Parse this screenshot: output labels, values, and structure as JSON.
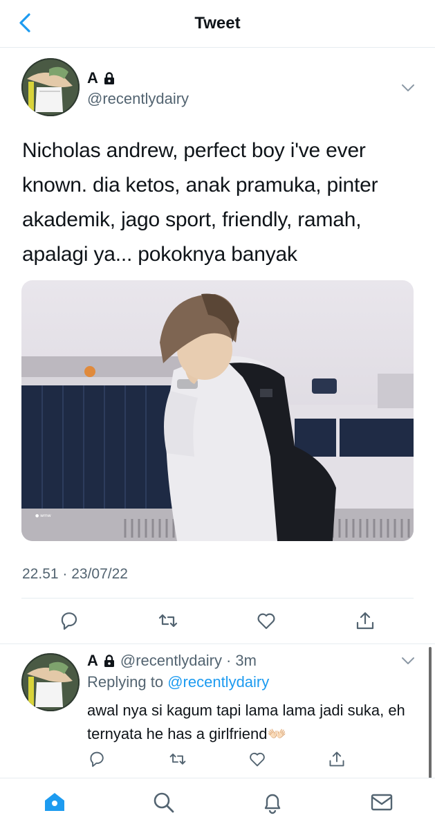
{
  "header": {
    "title": "Tweet",
    "back_icon": "chevron-left-icon"
  },
  "tweet": {
    "name": "A",
    "handle": "@recentlydairy",
    "text": "Nicholas andrew, perfect boy i've ever known. dia ketos, anak pramuka, pinter akademik, jago sport, friendly, ramah, apalagi ya... pokoknya banyak",
    "timestamp": "22.51 · 23/07/22",
    "media": {
      "alt_semantic": "photo-boy-with-backpack"
    }
  },
  "reply": {
    "name": "A",
    "handle": "@recentlydairy",
    "time": "· 3m",
    "replying_prefix": "Replying to",
    "replying_handle": "@recentlydairy",
    "text": "awal nya si kagum tapi lama lama jadi suka, eh ternyata he has a girlfriend",
    "emoji": "👐🏻"
  },
  "tabs": [
    "home-icon",
    "search-icon",
    "bell-icon",
    "mail-icon"
  ],
  "colors": {
    "accent": "#1d9bf0",
    "text": "#0f1419",
    "secondary": "#536471",
    "divider": "#e6ecf0"
  }
}
